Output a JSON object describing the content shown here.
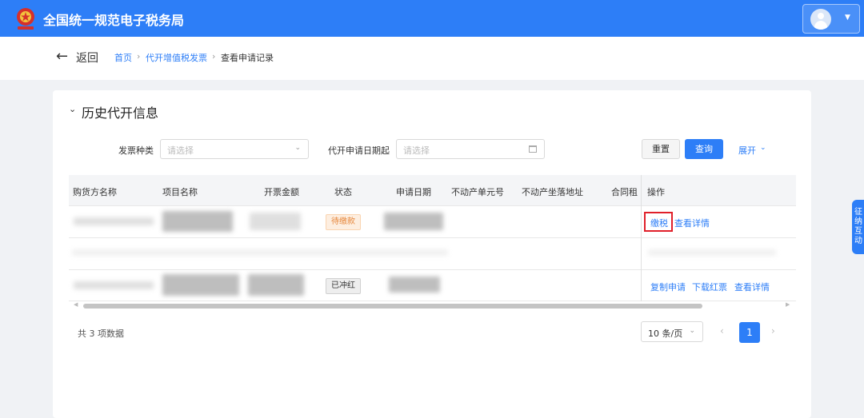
{
  "app": {
    "title": "全国统一规范电子税务局"
  },
  "nav": {
    "back_label": "返回",
    "breadcrumb": [
      "首页",
      "代开增值税发票",
      "查看申请记录"
    ]
  },
  "section": {
    "title": "历史代开信息"
  },
  "filters": {
    "invoice_type_label": "发票种类",
    "invoice_type_placeholder": "请选择",
    "date_label": "代开申请日期起",
    "date_placeholder": "请选择"
  },
  "actions": {
    "reset": "重置",
    "query": "查询",
    "expand": "展开"
  },
  "table": {
    "columns": [
      "购货方名称",
      "项目名称",
      "开票金额",
      "状态",
      "申请日期",
      "不动产单元号",
      "不动产坐落地址",
      "合同租",
      "操作"
    ],
    "rows": [
      {
        "status": "待缴款",
        "operations": [
          "缴税",
          "查看详情"
        ]
      },
      {
        "status": "",
        "operations": []
      },
      {
        "status": "已冲红",
        "operations": [
          "复制申请",
          "下载红票",
          "查看详情"
        ]
      }
    ]
  },
  "pagination": {
    "total_text": "共 3 项数据",
    "page_size": "10 条/页",
    "current_page": "1"
  },
  "side_tab": {
    "label": "征纳互动"
  },
  "colors": {
    "primary": "#2d7ef7",
    "highlight": "#e0202a",
    "pending": "#e6873c"
  }
}
